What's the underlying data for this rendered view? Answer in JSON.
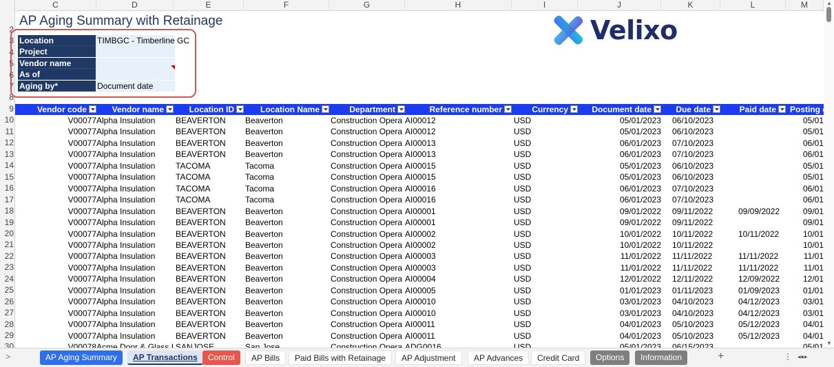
{
  "columns": [
    "C",
    "D",
    "E",
    "F",
    "G",
    "H",
    "I",
    "J",
    "K",
    "L",
    "M"
  ],
  "row_numbers": [
    "2",
    "3",
    "4",
    "5",
    "6",
    "7",
    "8",
    "9",
    "10",
    "11",
    "12",
    "13",
    "14",
    "15",
    "16",
    "17",
    "18",
    "19",
    "20",
    "21",
    "22",
    "23",
    "24",
    "25",
    "26",
    "27",
    "28",
    "29",
    "30"
  ],
  "title": "AP Aging Summary with Retainage",
  "params": [
    {
      "label": "Location",
      "value": "TIMBGC - Timberline GC"
    },
    {
      "label": "Project",
      "value": ""
    },
    {
      "label": "Vendor name",
      "value": ""
    },
    {
      "label": "As of",
      "value": ""
    },
    {
      "label": "Aging by*",
      "value": "Document date"
    }
  ],
  "logo": {
    "text": "Velixo",
    "icon": "velixo-x-logo-icon"
  },
  "table_headers": [
    "Vendor code",
    "Vendor name",
    "Location ID",
    "Location Name",
    "Department",
    "Reference number",
    "Currency",
    "Document date",
    "Due date",
    "Paid date",
    "Posting d"
  ],
  "rows": [
    [
      "V00077",
      "Alpha Insulation",
      "BEAVERTON",
      "Beaverton",
      "Construction Opera",
      "AI00012",
      "USD",
      "05/01/2023",
      "06/10/2023",
      "",
      "05/01"
    ],
    [
      "V00077",
      "Alpha Insulation",
      "BEAVERTON",
      "Beaverton",
      "Construction Opera",
      "AI00012",
      "USD",
      "05/01/2023",
      "06/10/2023",
      "",
      "05/01"
    ],
    [
      "V00077",
      "Alpha Insulation",
      "BEAVERTON",
      "Beaverton",
      "Construction Opera",
      "AI00013",
      "USD",
      "06/01/2023",
      "07/10/2023",
      "",
      "06/01"
    ],
    [
      "V00077",
      "Alpha Insulation",
      "BEAVERTON",
      "Beaverton",
      "Construction Opera",
      "AI00013",
      "USD",
      "06/01/2023",
      "07/10/2023",
      "",
      "06/01"
    ],
    [
      "V00077",
      "Alpha Insulation",
      "TACOMA",
      "Tacoma",
      "Construction Opera",
      "AI00015",
      "USD",
      "05/01/2023",
      "06/10/2023",
      "",
      "05/01"
    ],
    [
      "V00077",
      "Alpha Insulation",
      "TACOMA",
      "Tacoma",
      "Construction Opera",
      "AI00015",
      "USD",
      "05/01/2023",
      "06/10/2023",
      "",
      "05/01"
    ],
    [
      "V00077",
      "Alpha Insulation",
      "TACOMA",
      "Tacoma",
      "Construction Opera",
      "AI00016",
      "USD",
      "06/01/2023",
      "07/10/2023",
      "",
      "06/01"
    ],
    [
      "V00077",
      "Alpha Insulation",
      "TACOMA",
      "Tacoma",
      "Construction Opera",
      "AI00016",
      "USD",
      "06/01/2023",
      "07/10/2023",
      "",
      "06/01"
    ],
    [
      "V00077",
      "Alpha Insulation",
      "BEAVERTON",
      "Beaverton",
      "Construction Opera",
      "AI00001",
      "USD",
      "09/01/2022",
      "09/11/2022",
      "09/09/2022",
      "09/01"
    ],
    [
      "V00077",
      "Alpha Insulation",
      "BEAVERTON",
      "Beaverton",
      "Construction Opera",
      "AI00001",
      "USD",
      "09/01/2022",
      "09/11/2022",
      "",
      "09/01"
    ],
    [
      "V00077",
      "Alpha Insulation",
      "BEAVERTON",
      "Beaverton",
      "Construction Opera",
      "AI00002",
      "USD",
      "10/01/2022",
      "10/11/2022",
      "10/11/2022",
      "10/01"
    ],
    [
      "V00077",
      "Alpha Insulation",
      "BEAVERTON",
      "Beaverton",
      "Construction Opera",
      "AI00002",
      "USD",
      "10/01/2022",
      "10/11/2022",
      "",
      "10/01"
    ],
    [
      "V00077",
      "Alpha Insulation",
      "BEAVERTON",
      "Beaverton",
      "Construction Opera",
      "AI00003",
      "USD",
      "11/01/2022",
      "11/11/2022",
      "11/11/2022",
      "11/01"
    ],
    [
      "V00077",
      "Alpha Insulation",
      "BEAVERTON",
      "Beaverton",
      "Construction Opera",
      "AI00003",
      "USD",
      "11/01/2022",
      "11/11/2022",
      "11/11/2022",
      "11/01"
    ],
    [
      "V00077",
      "Alpha Insulation",
      "BEAVERTON",
      "Beaverton",
      "Construction Opera",
      "AI00004",
      "USD",
      "12/01/2022",
      "12/11/2022",
      "12/09/2022",
      "12/01"
    ],
    [
      "V00077",
      "Alpha Insulation",
      "BEAVERTON",
      "Beaverton",
      "Construction Opera",
      "AI00005",
      "USD",
      "01/01/2023",
      "01/11/2023",
      "01/09/2023",
      "01/01"
    ],
    [
      "V00077",
      "Alpha Insulation",
      "BEAVERTON",
      "Beaverton",
      "Construction Opera",
      "AI00010",
      "USD",
      "03/01/2023",
      "04/10/2023",
      "04/12/2023",
      "03/01"
    ],
    [
      "V00077",
      "Alpha Insulation",
      "BEAVERTON",
      "Beaverton",
      "Construction Opera",
      "AI00010",
      "USD",
      "03/01/2023",
      "04/10/2023",
      "04/12/2023",
      "03/01"
    ],
    [
      "V00077",
      "Alpha Insulation",
      "BEAVERTON",
      "Beaverton",
      "Construction Opera",
      "AI00011",
      "USD",
      "04/01/2023",
      "05/10/2023",
      "05/12/2023",
      "04/01"
    ],
    [
      "V00077",
      "Alpha Insulation",
      "BEAVERTON",
      "Beaverton",
      "Construction Opera",
      "AI00011",
      "USD",
      "04/01/2023",
      "05/10/2023",
      "05/12/2023",
      "04/01"
    ],
    [
      "V00078",
      "Acme Door & Glass I",
      "SANJOSE",
      "San Jose",
      "Construction Opera",
      "ADG0016",
      "USD",
      "05/01/2023",
      "06/15/2023",
      "",
      "05/01"
    ]
  ],
  "tabs": [
    {
      "label": "AP Aging Summary",
      "style": "blue"
    },
    {
      "label": "AP Transactions",
      "style": "active"
    },
    {
      "label": "Control",
      "style": "red"
    },
    {
      "label": "AP Bills",
      "style": "white"
    },
    {
      "label": "Paid Bills with Retainage",
      "style": "white"
    },
    {
      "label": "AP Adjustment",
      "style": "white"
    },
    {
      "label": "AP Advances",
      "style": "white"
    },
    {
      "label": "Credit Card",
      "style": "white"
    },
    {
      "label": "Options",
      "style": "gray"
    },
    {
      "label": "Information",
      "style": "gray"
    }
  ],
  "tabbar": {
    "nav": ">",
    "plus": "+",
    "more": "⋮",
    "scroll": "◂●▸"
  },
  "colors": {
    "header_blue": "#1a3cf5",
    "param_navy": "#1f3864",
    "highlight_red": "#d9534f"
  }
}
